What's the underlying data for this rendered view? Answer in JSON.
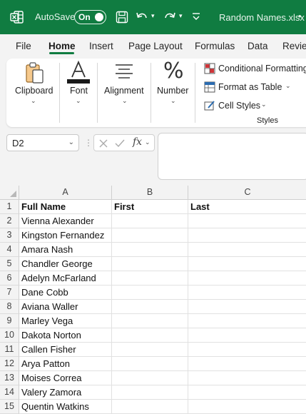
{
  "titlebar": {
    "autosave_label": "AutoSave",
    "autosave_state": "On",
    "filename": "Random Names.xlsx",
    "unsaved_marker": "•",
    "bg_color": "#107c41"
  },
  "tabs": [
    {
      "label": "File"
    },
    {
      "label": "Home"
    },
    {
      "label": "Insert"
    },
    {
      "label": "Page Layout"
    },
    {
      "label": "Formulas"
    },
    {
      "label": "Data"
    },
    {
      "label": "Review"
    }
  ],
  "ribbon": {
    "clipboard": "Clipboard",
    "font": "Font",
    "alignment": "Alignment",
    "number": "Number",
    "conditional_formatting": "Conditional Formatting",
    "format_as_table": "Format as Table",
    "cell_styles": "Cell Styles",
    "styles_group": "Styles"
  },
  "formula_bar": {
    "name_box": "D2",
    "fx": "fx",
    "value": ""
  },
  "grid": {
    "columns": [
      "A",
      "B",
      "C"
    ],
    "rows": [
      {
        "num": "1",
        "a": "Full Name",
        "b": "First",
        "c": "Last"
      },
      {
        "num": "2",
        "a": "Vienna Alexander",
        "b": "",
        "c": ""
      },
      {
        "num": "3",
        "a": "Kingston Fernandez",
        "b": "",
        "c": ""
      },
      {
        "num": "4",
        "a": "Amara Nash",
        "b": "",
        "c": ""
      },
      {
        "num": "5",
        "a": "Chandler George",
        "b": "",
        "c": ""
      },
      {
        "num": "6",
        "a": "Adelyn McFarland",
        "b": "",
        "c": ""
      },
      {
        "num": "7",
        "a": "Dane Cobb",
        "b": "",
        "c": ""
      },
      {
        "num": "8",
        "a": "Aviana Waller",
        "b": "",
        "c": ""
      },
      {
        "num": "9",
        "a": "Marley Vega",
        "b": "",
        "c": ""
      },
      {
        "num": "10",
        "a": "Dakota Norton",
        "b": "",
        "c": ""
      },
      {
        "num": "11",
        "a": "Callen Fisher",
        "b": "",
        "c": ""
      },
      {
        "num": "12",
        "a": "Arya Patton",
        "b": "",
        "c": ""
      },
      {
        "num": "13",
        "a": "Moises Correa",
        "b": "",
        "c": ""
      },
      {
        "num": "14",
        "a": "Valery Zamora",
        "b": "",
        "c": ""
      },
      {
        "num": "15",
        "a": "Quentin Watkins",
        "b": "",
        "c": ""
      }
    ]
  }
}
